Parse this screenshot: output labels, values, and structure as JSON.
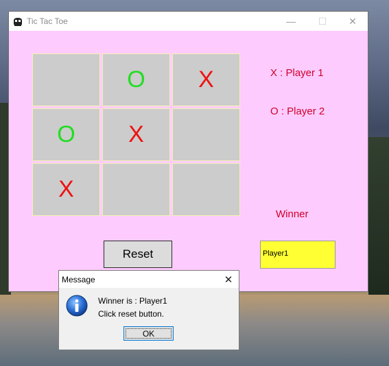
{
  "window": {
    "title": "Tic Tac Toe",
    "minimize": "—",
    "maximize": "☐",
    "close": "✕"
  },
  "board": {
    "cells": [
      "",
      "O",
      "X",
      "O",
      "X",
      "",
      "X",
      "",
      ""
    ]
  },
  "legend": {
    "x_label": "X :  Player 1",
    "o_label": "O :  Player 2",
    "winner_label": "Winner"
  },
  "reset_label": "Reset",
  "winner_value": "Player1",
  "dialog": {
    "title": "Message",
    "close": "✕",
    "line1": "Winner is : Player1",
    "line2": "Click reset button.",
    "ok_label": "OK"
  },
  "colors": {
    "window_bg": "#fdcbfd",
    "x_mark": "#ee1111",
    "o_mark": "#22dd22",
    "legend_text": "#d1002c",
    "winner_box": "#ffff33"
  }
}
